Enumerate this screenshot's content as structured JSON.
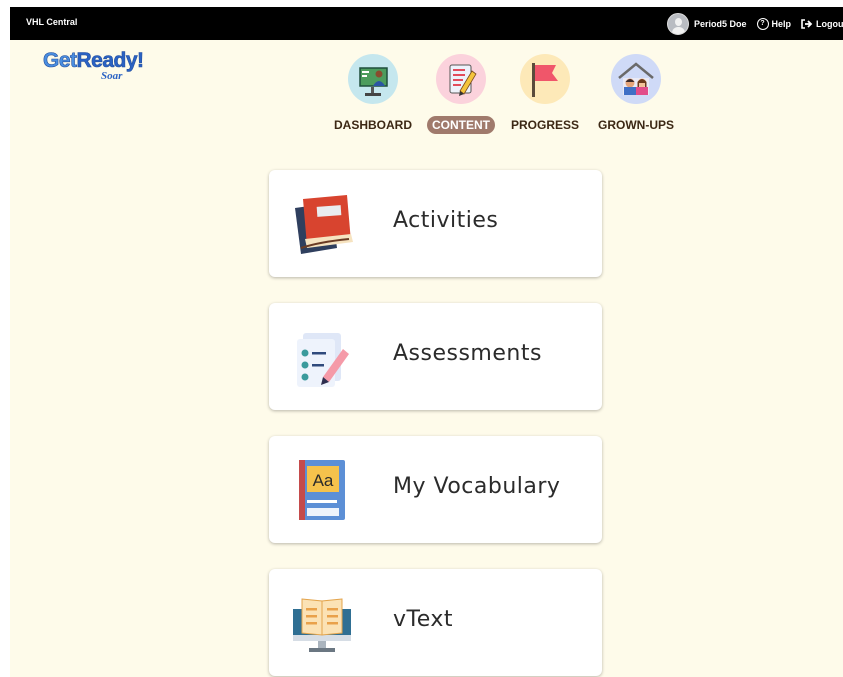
{
  "topbar": {
    "brand": "VHL Central",
    "user_name": "Period5 Doe",
    "help_label": "Help",
    "logout_label": "Logout"
  },
  "logo": {
    "main_get": "Get",
    "main_ready": "Ready!",
    "sub": "Soar"
  },
  "nav": {
    "items": [
      {
        "label": "DASHBOARD",
        "icon": "teacher-board-icon",
        "active": false
      },
      {
        "label": "CONTENT",
        "icon": "notebook-pencil-icon",
        "active": true
      },
      {
        "label": "PROGRESS",
        "icon": "flag-icon",
        "active": false
      },
      {
        "label": "GROWN-UPS",
        "icon": "family-house-icon",
        "active": false
      }
    ]
  },
  "cards": [
    {
      "label": "Activities",
      "icon": "book-stack-icon"
    },
    {
      "label": "Assessments",
      "icon": "checklist-pencil-icon"
    },
    {
      "label": "My Vocabulary",
      "icon": "dictionary-book-icon"
    },
    {
      "label": "vText",
      "icon": "ebook-monitor-icon"
    }
  ],
  "colors": {
    "page_bg": "#fefbea",
    "topbar_bg": "#000000",
    "active_pill": "#a07a6c",
    "nav_text": "#3c2814",
    "card_text": "#2b2b2b"
  }
}
